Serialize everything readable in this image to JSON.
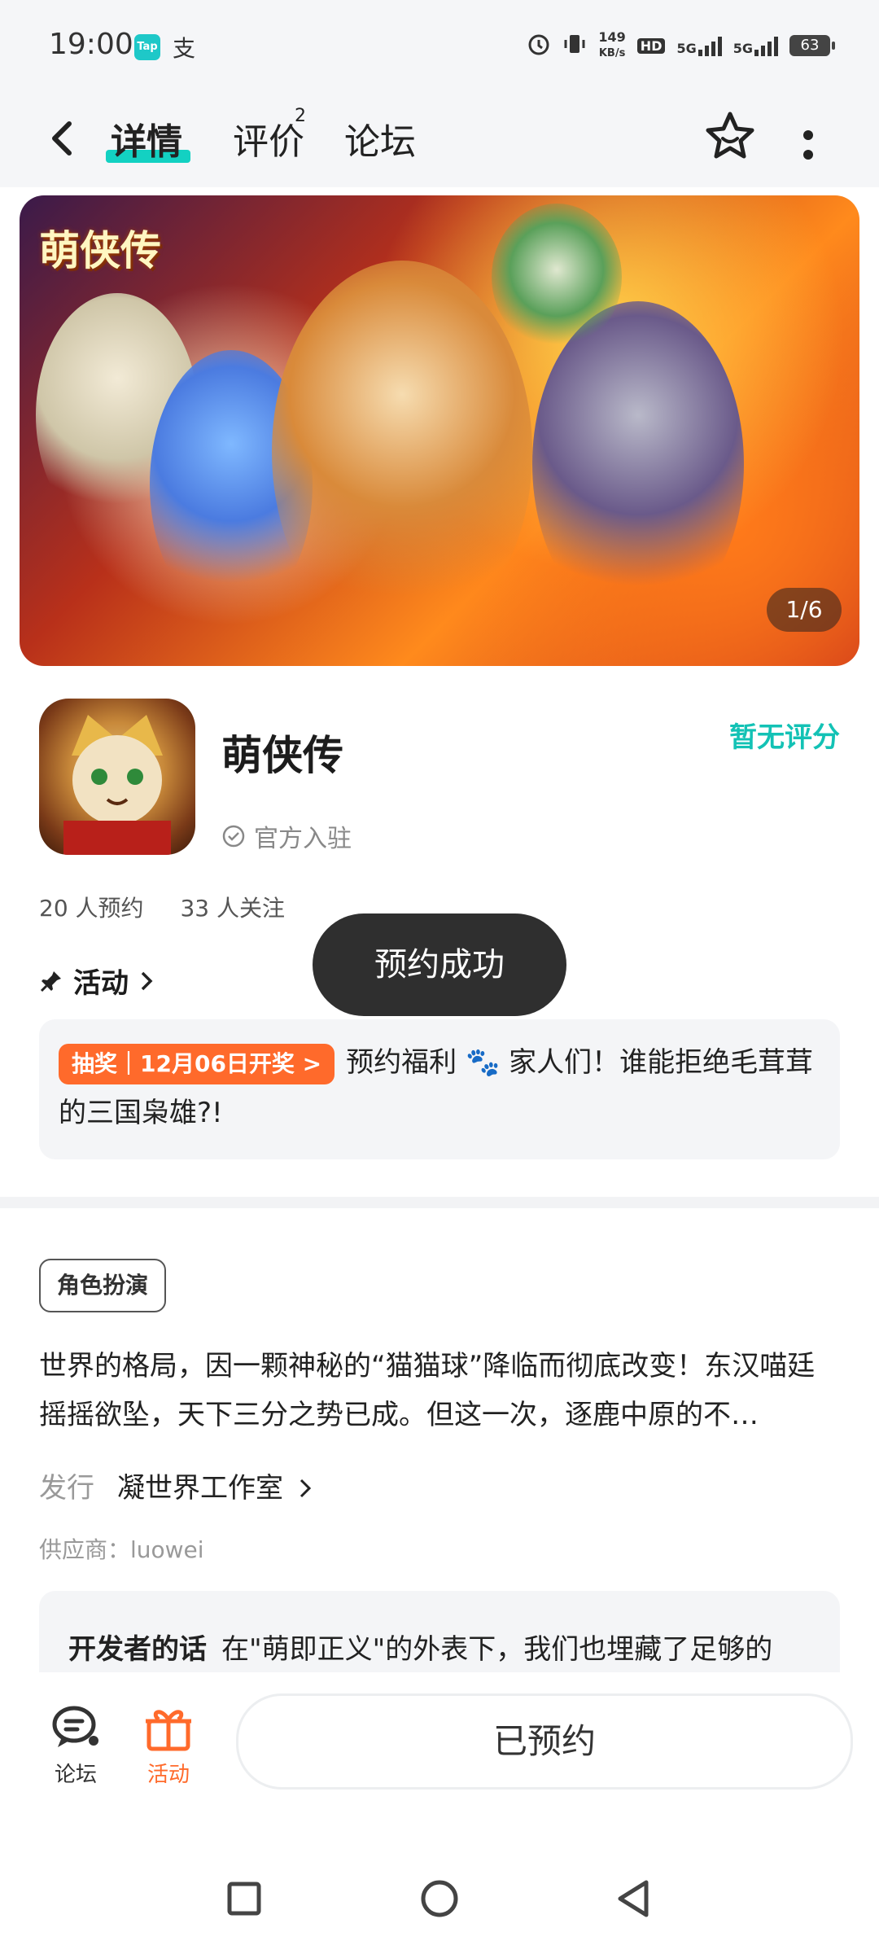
{
  "status_bar": {
    "time": "19:00",
    "tap_badge": "Tap",
    "alipay_glyph": "支",
    "net_speed_value": "149",
    "net_speed_unit": "KB/s",
    "hd_label": "HD",
    "sig1_label": "5G",
    "sig2_label": "5G",
    "battery": "63"
  },
  "header": {
    "tabs": [
      {
        "label": "详情",
        "active": true
      },
      {
        "label": "评价",
        "badge": "2"
      },
      {
        "label": "论坛"
      }
    ]
  },
  "banner": {
    "logo_text": "萌侠传",
    "page_indicator": "1/6"
  },
  "app": {
    "title": "萌侠传",
    "official_label": "官方入驻",
    "rating_text": "暂无评分",
    "reservations": "20 人预约",
    "followers": "33 人关注"
  },
  "activity": {
    "section_title": "活动",
    "lottery_badge": "抽奖｜12月06日开奖 >",
    "text": "预约福利 🐾 家人们！谁能拒绝毛茸茸的三国枭雄?!"
  },
  "toast": {
    "text": "预约成功"
  },
  "details": {
    "tag": "角色扮演",
    "description": "世界的格局，因一颗神秘的“猫猫球”降临而彻底改变！东汉喵廷摇摇欲坠，天下三分之势已成。但这一次，逐鹿中原的不…",
    "publisher_label": "发行",
    "publisher_name": "凝世界工作室",
    "supplier": "供应商：luowei",
    "dev_label": "开发者的话",
    "dev_text": "在\"萌即正义\"的外表下，我们也埋藏了足够的"
  },
  "bottom_bar": {
    "forum_label": "论坛",
    "activity_label": "活动",
    "reserved_button": "已预约"
  },
  "colors": {
    "accent_teal": "#13c2b5",
    "accent_orange": "#ff6a2b",
    "toast_bg": "#2f2f2f"
  }
}
